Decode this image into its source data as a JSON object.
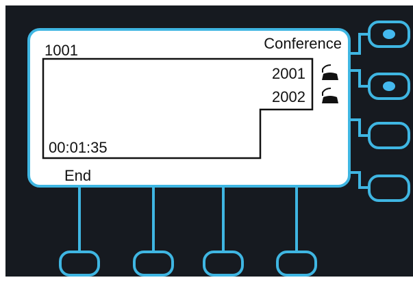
{
  "display": {
    "line_extension": "1001",
    "call_state": "Conference",
    "parties": [
      {
        "number": "2001",
        "icon": "handset-off-hook-icon"
      },
      {
        "number": "2002",
        "icon": "handset-off-hook-icon"
      }
    ],
    "call_timer": "00:01:35",
    "softkeys": [
      "End",
      "",
      "",
      ""
    ]
  },
  "line_buttons": [
    {
      "state": "active"
    },
    {
      "state": "active"
    },
    {
      "state": "idle"
    },
    {
      "state": "idle"
    }
  ],
  "colors": {
    "bezel": "#161a20",
    "accent": "#3fb6e2",
    "indicator": "#44b9ee",
    "screen": "#ffffff",
    "text": "#111111"
  }
}
